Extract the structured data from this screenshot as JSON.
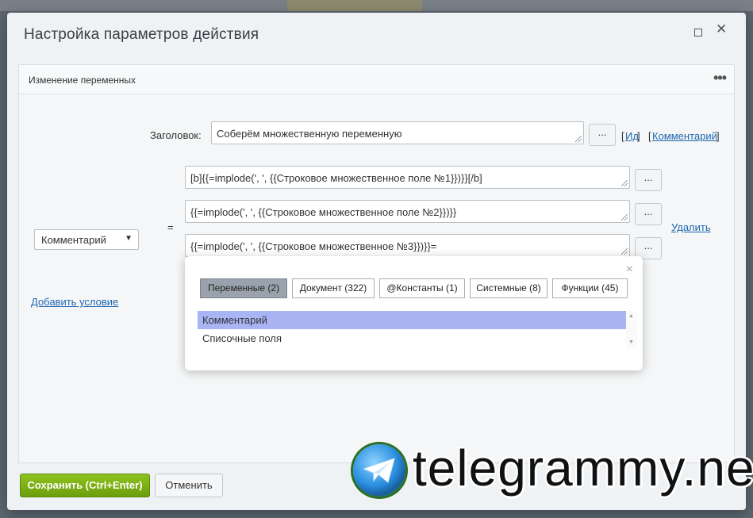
{
  "dialog": {
    "title": "Настройка параметров действия"
  },
  "panel": {
    "title": "Изменение переменных",
    "more_label": "•••"
  },
  "form": {
    "title_label": "Заголовок:",
    "title_value": "Соберём множественную переменную",
    "dots_label": "...",
    "id_link": "Ид",
    "comment_link": "Комментарий",
    "bracket_open": "[",
    "bracket_close": "]",
    "variable_select": "Комментарий",
    "equals": "=",
    "expressions": [
      "[b]{{=implode(', ', {{Строковое множественное поле №1}})}}[/b]",
      "{{=implode(', ', {{Строковое множественное поле №2}})}}",
      "{{=implode(', ', {{Строковое множественное №3}})}}="
    ],
    "delete_link": "Удалить",
    "add_condition_link": "Добавить условие"
  },
  "popup": {
    "close": "×",
    "tabs": [
      "Переменные (2)",
      "Документ (322)",
      "@Константы (1)",
      "Системные (8)",
      "Функции (45)"
    ],
    "items": [
      "Комментарий",
      "Списочные поля"
    ]
  },
  "footer": {
    "save": "Сохранить (Ctrl+Enter)",
    "cancel": "Отменить"
  },
  "watermark": {
    "text": "telegrammy.net"
  }
}
